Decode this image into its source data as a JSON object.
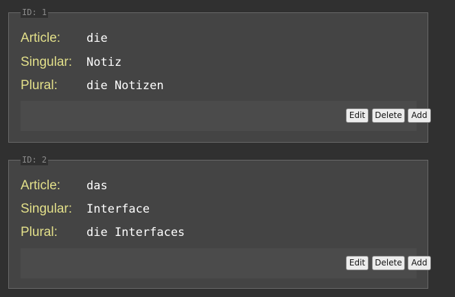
{
  "labels": {
    "article": "Article:",
    "singular": "Singular:",
    "plural": "Plural:"
  },
  "buttons": {
    "edit": "Edit",
    "delete": "Delete",
    "add": "Add"
  },
  "cards": [
    {
      "id_label": "ID: 1",
      "article": "die",
      "singular": "Notiz",
      "plural": "die Notizen"
    },
    {
      "id_label": "ID: 2",
      "article": "das",
      "singular": "Interface",
      "plural": "die Interfaces"
    }
  ],
  "colors": {
    "background": "#303030",
    "card": "#444444",
    "label": "#e3e08a",
    "value": "#ffffff"
  }
}
